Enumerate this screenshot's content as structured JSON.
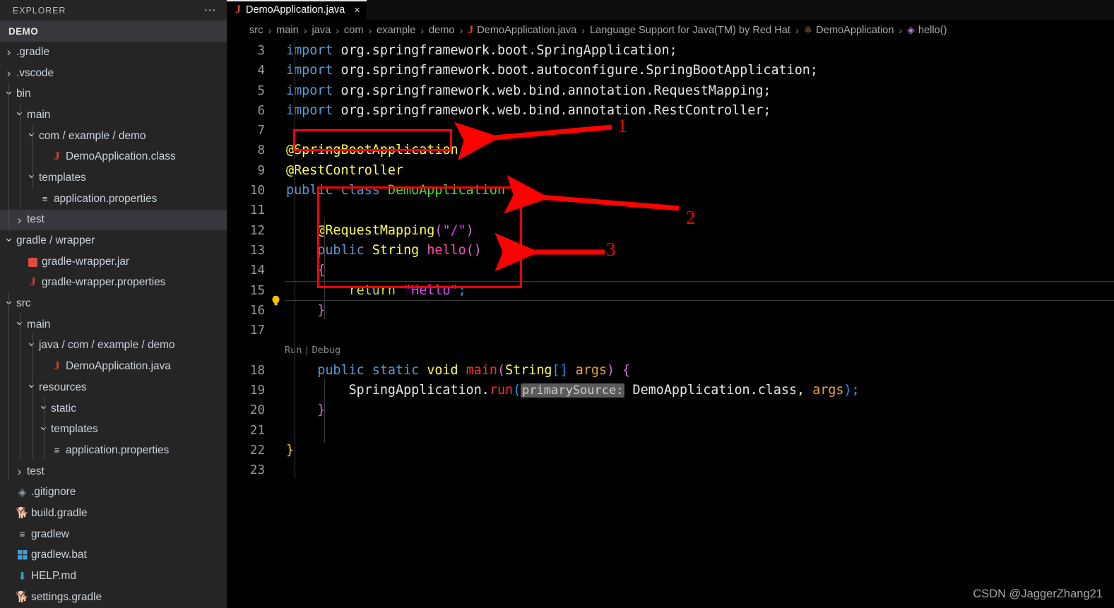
{
  "sidebar": {
    "title": "EXPLORER",
    "overflow_icon": "ellipsis-icon",
    "project": "DEMO",
    "items": [
      {
        "label": ".gradle",
        "indent": 0,
        "state": "collapsed",
        "icon": "folder"
      },
      {
        "label": ".vscode",
        "indent": 0,
        "state": "collapsed",
        "icon": "folder"
      },
      {
        "label": "bin",
        "indent": 0,
        "state": "expanded",
        "icon": "folder"
      },
      {
        "label": "main",
        "indent": 1,
        "state": "expanded",
        "icon": "folder"
      },
      {
        "label": "com / example / demo",
        "indent": 2,
        "state": "expanded",
        "icon": "folder"
      },
      {
        "label": "DemoApplication.class",
        "indent": 3,
        "state": "file",
        "icon": "java-file-icon"
      },
      {
        "label": "templates",
        "indent": 2,
        "state": "expanded",
        "icon": "folder"
      },
      {
        "label": "application.properties",
        "indent": 2,
        "state": "file",
        "icon": "properties-file-icon"
      },
      {
        "label": "test",
        "indent": 1,
        "state": "collapsed",
        "icon": "folder",
        "selected": true
      },
      {
        "label": "gradle / wrapper",
        "indent": 0,
        "state": "expanded",
        "icon": "folder"
      },
      {
        "label": "gradle-wrapper.jar",
        "indent": 1,
        "state": "file",
        "icon": "jar-file-icon"
      },
      {
        "label": "gradle-wrapper.properties",
        "indent": 1,
        "state": "file",
        "icon": "java-file-icon"
      },
      {
        "label": "src",
        "indent": 0,
        "state": "expanded",
        "icon": "folder"
      },
      {
        "label": "main",
        "indent": 1,
        "state": "expanded",
        "icon": "folder"
      },
      {
        "label": "java / com / example / demo",
        "indent": 2,
        "state": "expanded",
        "icon": "folder"
      },
      {
        "label": "DemoApplication.java",
        "indent": 3,
        "state": "file",
        "icon": "java-file-icon"
      },
      {
        "label": "resources",
        "indent": 2,
        "state": "expanded",
        "icon": "folder"
      },
      {
        "label": "static",
        "indent": 3,
        "state": "expanded",
        "icon": "folder"
      },
      {
        "label": "templates",
        "indent": 3,
        "state": "expanded",
        "icon": "folder"
      },
      {
        "label": "application.properties",
        "indent": 3,
        "state": "file",
        "icon": "properties-file-icon"
      },
      {
        "label": "test",
        "indent": 1,
        "state": "collapsed",
        "icon": "folder"
      },
      {
        "label": ".gitignore",
        "indent": 0,
        "state": "file",
        "icon": "git-file-icon"
      },
      {
        "label": "build.gradle",
        "indent": 0,
        "state": "file",
        "icon": "gradle-file-icon"
      },
      {
        "label": "gradlew",
        "indent": 0,
        "state": "file",
        "icon": "script-file-icon"
      },
      {
        "label": "gradlew.bat",
        "indent": 0,
        "state": "file",
        "icon": "windows-file-icon"
      },
      {
        "label": "HELP.md",
        "indent": 0,
        "state": "file",
        "icon": "markdown-file-icon"
      },
      {
        "label": "settings.gradle",
        "indent": 0,
        "state": "file",
        "icon": "gradle-file-icon"
      }
    ]
  },
  "tab": {
    "label": "DemoApplication.java",
    "icon": "java-file-icon",
    "close_icon": "close-icon",
    "close_glyph": "×"
  },
  "breadcrumb": [
    {
      "label": "src",
      "icon": null
    },
    {
      "label": "main",
      "icon": null
    },
    {
      "label": "java",
      "icon": null
    },
    {
      "label": "com",
      "icon": null
    },
    {
      "label": "example",
      "icon": null
    },
    {
      "label": "demo",
      "icon": null
    },
    {
      "label": "DemoApplication.java",
      "icon": "java-file-icon"
    },
    {
      "label": "Language Support for Java(TM) by Red Hat",
      "icon": null
    },
    {
      "label": "DemoApplication",
      "icon": "class-symbol-icon"
    },
    {
      "label": "hello()",
      "icon": "method-symbol-icon"
    }
  ],
  "code": {
    "runbar": {
      "run": "Run",
      "separator": "|",
      "debug": "Debug"
    },
    "lines": [
      {
        "n": "3",
        "tokens": [
          {
            "t": "import ",
            "c": "k"
          },
          {
            "t": "org.springframework.boot.SpringApplication;",
            "c": "pkg"
          }
        ]
      },
      {
        "n": "4",
        "tokens": [
          {
            "t": "import ",
            "c": "k"
          },
          {
            "t": "org.springframework.boot.autoconfigure.SpringBootApplication;",
            "c": "pkg"
          }
        ]
      },
      {
        "n": "5",
        "tokens": [
          {
            "t": "import ",
            "c": "k"
          },
          {
            "t": "org.springframework.web.bind.annotation.RequestMapping;",
            "c": "pkg"
          }
        ]
      },
      {
        "n": "6",
        "tokens": [
          {
            "t": "import ",
            "c": "k"
          },
          {
            "t": "org.springframework.web.bind.annotation.RestController;",
            "c": "pkg"
          }
        ]
      },
      {
        "n": "7",
        "tokens": []
      },
      {
        "n": "8",
        "tokens": [
          {
            "t": "@SpringBootApplication",
            "c": "ann"
          }
        ]
      },
      {
        "n": "9",
        "tokens": [
          {
            "t": "@RestController",
            "c": "ann"
          }
        ]
      },
      {
        "n": "10",
        "tokens": [
          {
            "t": "public class ",
            "c": "k"
          },
          {
            "t": "DemoApplication",
            "c": "cls"
          },
          {
            "t": " ",
            "c": "pkg"
          },
          {
            "t": "{",
            "c": "br1"
          }
        ]
      },
      {
        "n": "11",
        "tokens": []
      },
      {
        "n": "12",
        "tokens": [
          {
            "t": "    @RequestMapping",
            "c": "ann"
          },
          {
            "t": "(",
            "c": "br2"
          },
          {
            "t": "\"/\"",
            "c": "str"
          },
          {
            "t": ")",
            "c": "br2"
          }
        ]
      },
      {
        "n": "13",
        "tokens": [
          {
            "t": "    public ",
            "c": "k"
          },
          {
            "t": "String ",
            "c": "typ"
          },
          {
            "t": "hello",
            "c": "mth"
          },
          {
            "t": "()",
            "c": "br2"
          }
        ]
      },
      {
        "n": "14",
        "tokens": [
          {
            "t": "    {",
            "c": "br2"
          }
        ]
      },
      {
        "n": "15",
        "tokens": [
          {
            "t": "        return ",
            "c": "ret"
          },
          {
            "t": "\"Hello\"",
            "c": "str"
          },
          {
            "t": ";",
            "c": "br3"
          }
        ],
        "current": true,
        "bulb": true
      },
      {
        "n": "16",
        "tokens": [
          {
            "t": "    }",
            "c": "br2"
          }
        ]
      },
      {
        "n": "17",
        "tokens": []
      },
      {
        "n": "18",
        "tokens": [
          {
            "t": "    public static ",
            "c": "k"
          },
          {
            "t": "void ",
            "c": "typ"
          },
          {
            "t": "main",
            "c": "run"
          },
          {
            "t": "(",
            "c": "br2"
          },
          {
            "t": "String",
            "c": "typ"
          },
          {
            "t": "[] ",
            "c": "br3"
          },
          {
            "t": "args",
            "c": "var"
          },
          {
            "t": ")",
            "c": "br2"
          },
          {
            "t": " ",
            "c": "pkg"
          },
          {
            "t": "{",
            "c": "br2"
          }
        ]
      },
      {
        "n": "19",
        "tokens": [
          {
            "t": "        SpringApplication.",
            "c": "pkg"
          },
          {
            "t": "run",
            "c": "run"
          },
          {
            "t": "(",
            "c": "br3"
          },
          {
            "t": "primarySource:",
            "c": "hint"
          },
          {
            "t": " DemoApplication.class, ",
            "c": "pkg"
          },
          {
            "t": "args",
            "c": "var"
          },
          {
            "t": ");",
            "c": "br3"
          }
        ]
      },
      {
        "n": "20",
        "tokens": [
          {
            "t": "    }",
            "c": "br2"
          }
        ]
      },
      {
        "n": "21",
        "tokens": []
      },
      {
        "n": "22",
        "tokens": [
          {
            "t": "}",
            "c": "br1"
          }
        ]
      },
      {
        "n": "23",
        "tokens": []
      }
    ]
  },
  "annotations": {
    "color": "#ff0000",
    "markers": [
      {
        "number": "1",
        "target": "@RestController"
      },
      {
        "number": "2",
        "target": "@RequestMapping(\"/\")"
      },
      {
        "number": "3",
        "target": "return \"Hello\";"
      }
    ]
  },
  "watermark": "CSDN @JaggerZhang21"
}
